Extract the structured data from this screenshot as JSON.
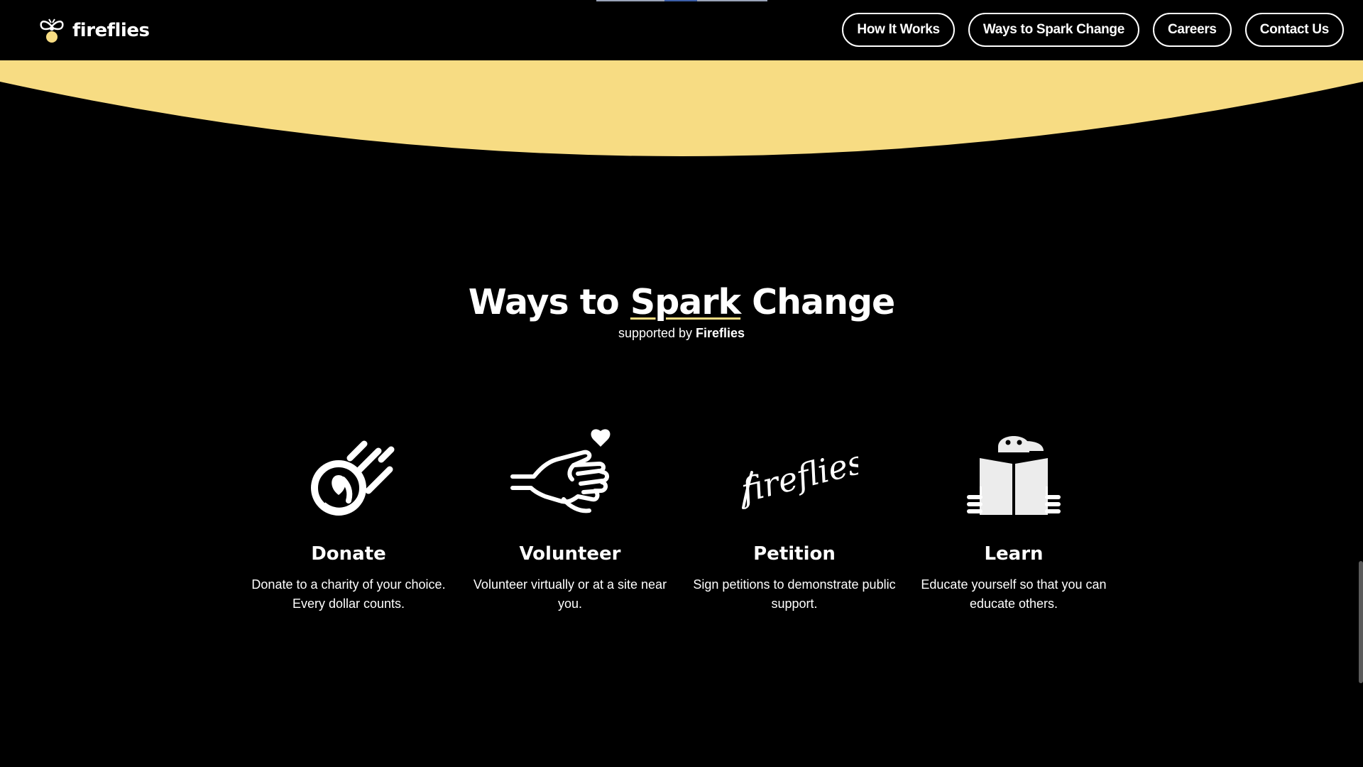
{
  "brand": {
    "name": "fireflies"
  },
  "nav": [
    {
      "label": "How It Works"
    },
    {
      "label": "Ways to Spark Change"
    },
    {
      "label": "Careers"
    },
    {
      "label": "Contact Us"
    }
  ],
  "section": {
    "heading_pre": "Ways to ",
    "heading_spark": "Spark",
    "heading_post": " Change",
    "sub_pre": "supported by ",
    "sub_brand": "Fireflies"
  },
  "cards": [
    {
      "icon": "heart-comet-icon",
      "title": "Donate",
      "desc": "Donate to a charity of your choice. Every dollar counts."
    },
    {
      "icon": "hand-heart-icon",
      "title": "Volunteer",
      "desc": "Volunteer virtually or at a site near you."
    },
    {
      "icon": "fireflies-signature-icon",
      "title": "Petition",
      "desc": "Sign petitions to demonstrate public support.",
      "signature_text": "fireflies"
    },
    {
      "icon": "reader-icon",
      "title": "Learn",
      "desc": "Educate yourself so that you can educate others."
    }
  ],
  "colors": {
    "accent_yellow": "#f7dc83",
    "background": "#000000"
  }
}
